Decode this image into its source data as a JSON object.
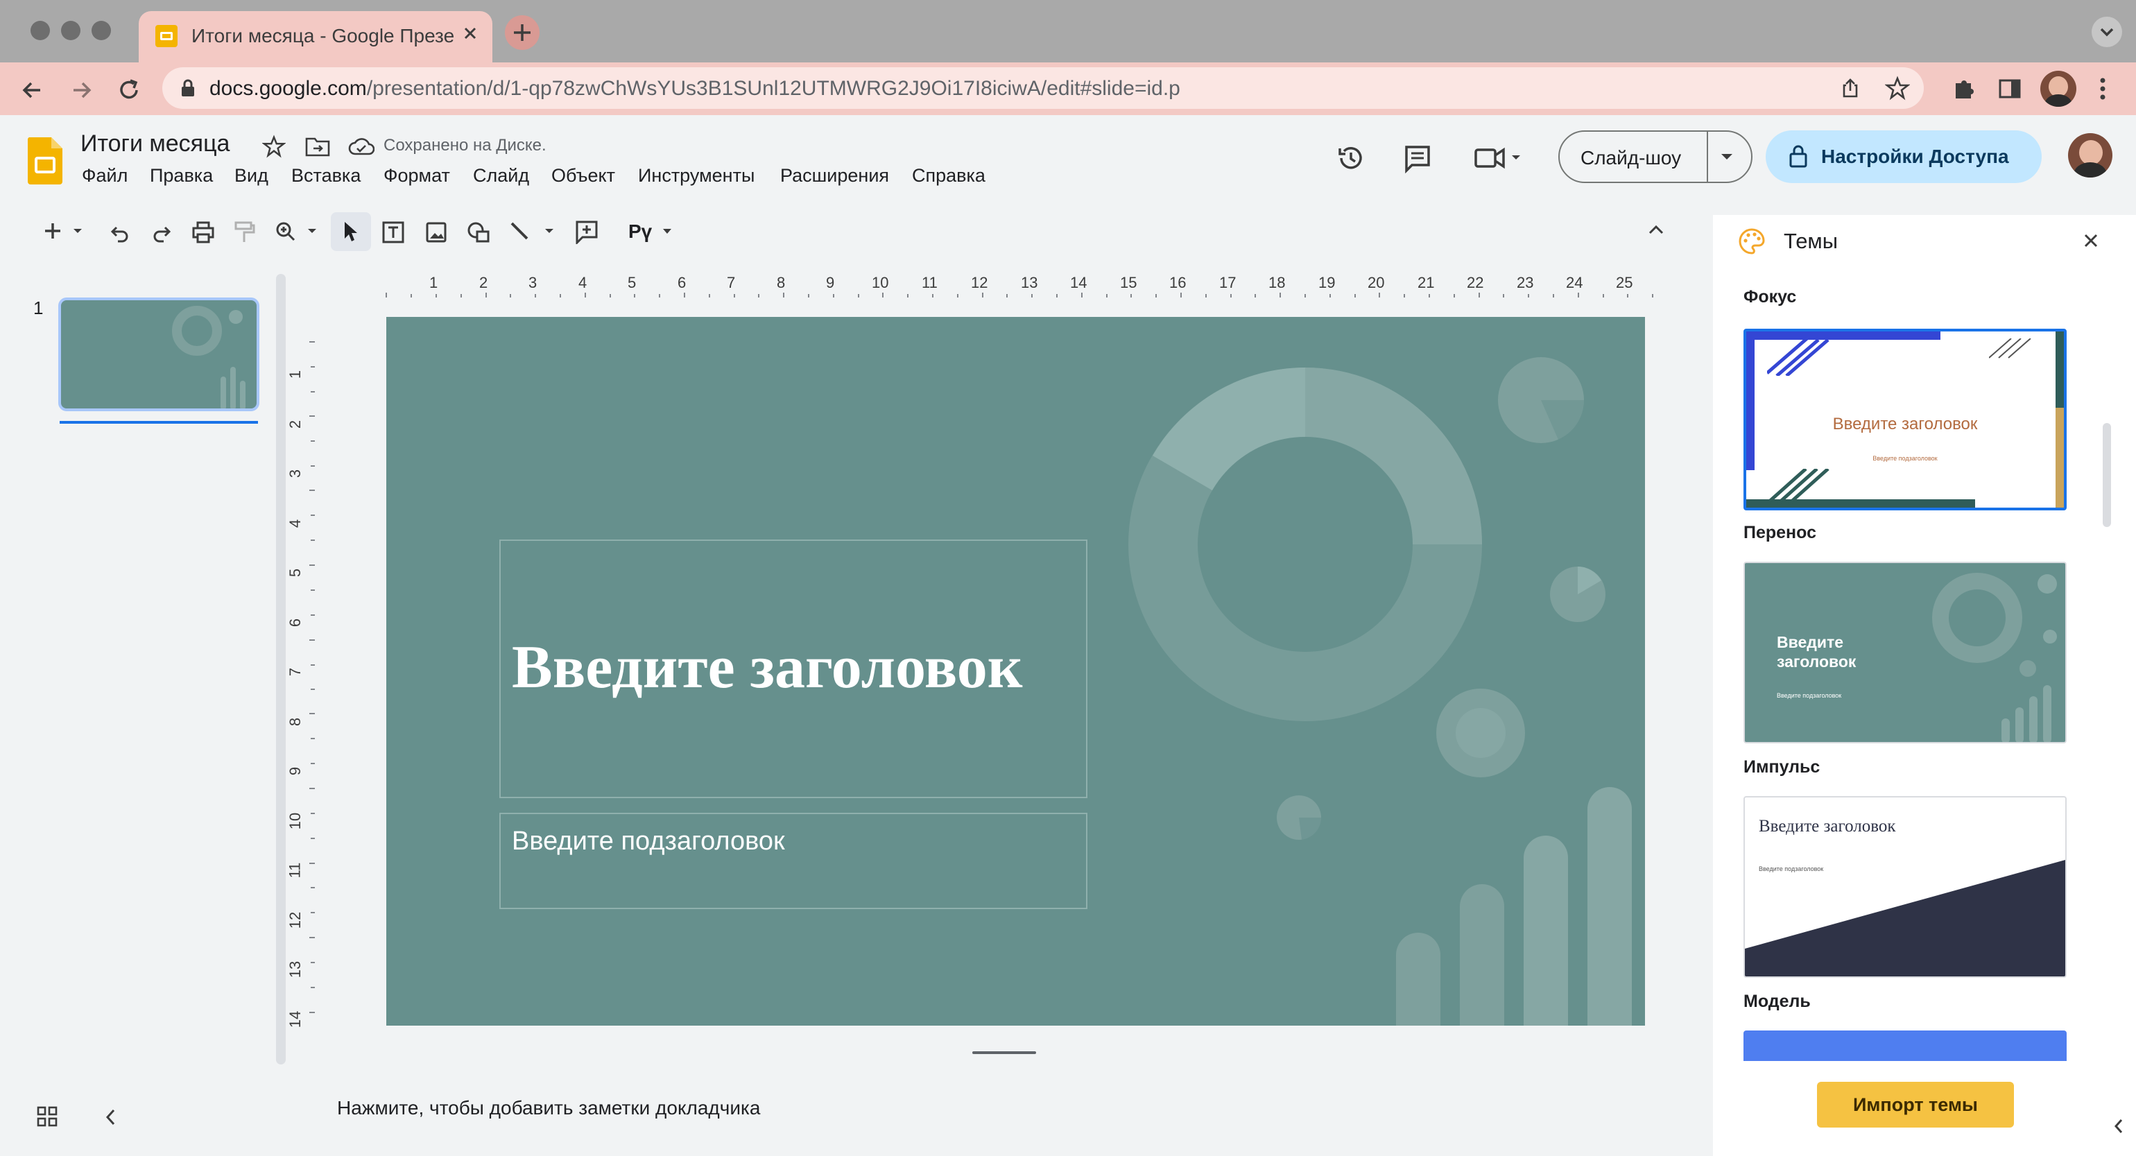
{
  "browser": {
    "tab_title": "Итоги месяца - Google Презе",
    "url_domain": "docs.google.com",
    "url_path": "/presentation/d/1-qp78zwChWsYUs3B1SUnl12UTMWRG2J9Oi17I8iciwA/edit#slide=id.p"
  },
  "app": {
    "doc_title": "Итоги месяца",
    "save_status": "Сохранено на Диске.",
    "menu": [
      "Файл",
      "Правка",
      "Вид",
      "Вставка",
      "Формат",
      "Слайд",
      "Объект",
      "Инструменты",
      "Расширения",
      "Справка"
    ],
    "slideshow_label": "Слайд-шоу",
    "share_label": "Настройки Доступа"
  },
  "toolbar": {
    "input_tools_label": "Рү"
  },
  "ruler": {
    "horizontal": [
      "1",
      "2",
      "3",
      "4",
      "5",
      "6",
      "7",
      "8",
      "9",
      "10",
      "11",
      "12",
      "13",
      "14",
      "15",
      "16",
      "17",
      "18",
      "19",
      "20",
      "21",
      "22",
      "23",
      "24",
      "25"
    ],
    "vertical": [
      "1",
      "2",
      "3",
      "4",
      "5",
      "6",
      "7",
      "8",
      "9",
      "10",
      "11",
      "12",
      "13",
      "14"
    ]
  },
  "filmstrip": {
    "slide_number": "1"
  },
  "slide": {
    "title": "Введите заголовок",
    "subtitle": "Введите подзаголовок"
  },
  "notes": {
    "placeholder": "Нажмите, чтобы добавить заметки докладчика"
  },
  "themes_panel": {
    "title": "Темы",
    "themes": [
      {
        "name": "Фокус",
        "card_title": "Введите заголовок",
        "card_subtitle": "Введите подзаголовок"
      },
      {
        "name": "Перенос",
        "card_title": "Введите заголовок",
        "card_subtitle": "Введите подзаголовок"
      },
      {
        "name": "Импульс",
        "card_title": "Введите заголовок",
        "card_subtitle": "Введите подзаголовок"
      },
      {
        "name": "Модель",
        "card_title": "",
        "card_subtitle": ""
      }
    ],
    "import_label": "Импорт темы"
  },
  "colors": {
    "slide_bg": "#66908d",
    "accent_blue": "#1a73e8",
    "import_button": "#f5c242",
    "share_button": "#c2e7ff"
  },
  "icons": [
    "back-icon",
    "forward-icon",
    "reload-icon",
    "lock-icon",
    "share-page-icon",
    "bookmark-star-icon",
    "extensions-icon",
    "side-panel-icon",
    "menu-dots-icon",
    "slides-logo-icon",
    "star-icon",
    "move-folder-icon",
    "cloud-saved-icon",
    "history-icon",
    "comments-icon",
    "meet-icon",
    "palette-icon",
    "close-icon",
    "grid-view-icon",
    "collapse-icon"
  ]
}
